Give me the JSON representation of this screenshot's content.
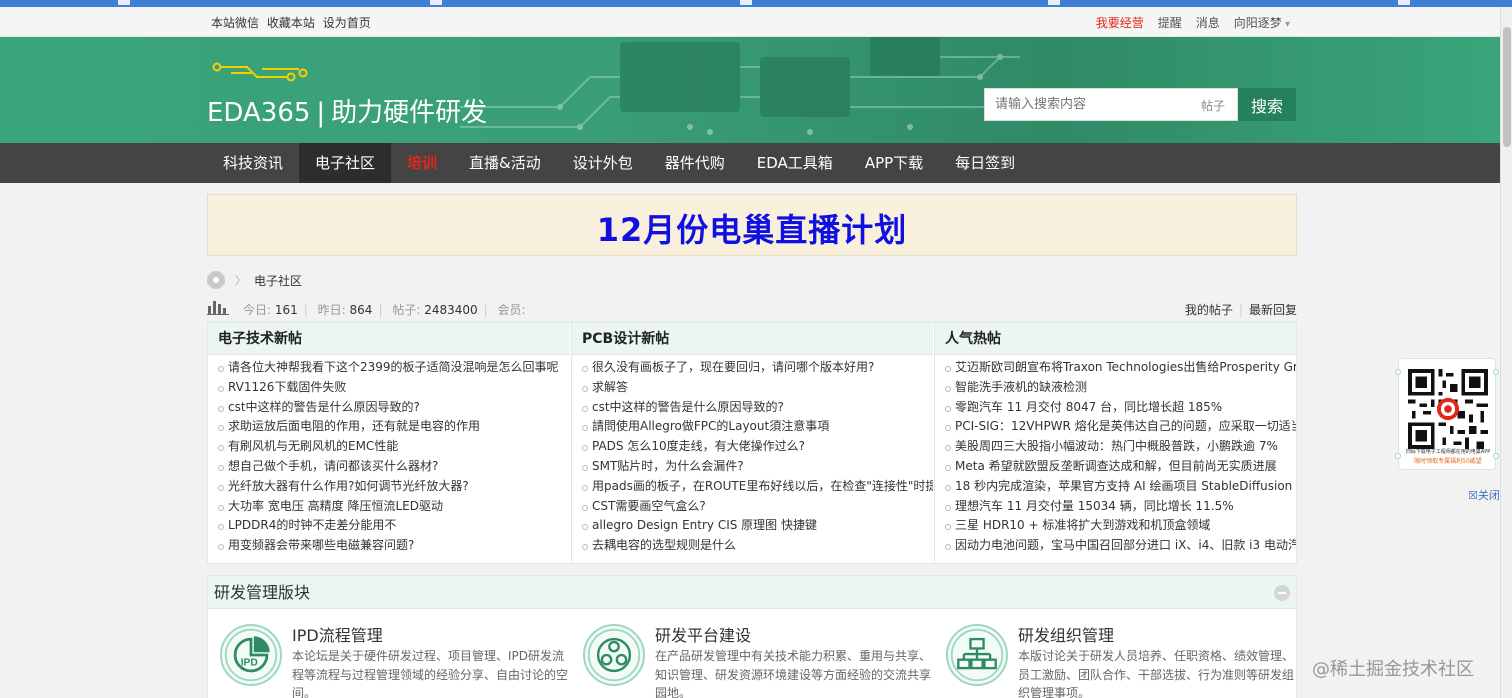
{
  "topbar": {
    "links": [
      "本站微信",
      "收藏本站",
      "设为首页"
    ],
    "right": {
      "biz": "我要经营",
      "remind": "提醒",
      "msg": "消息",
      "user": "向阳逐梦"
    }
  },
  "header": {
    "logo_text": "EDA365",
    "slogan": "助力硬件研发",
    "search": {
      "placeholder": "请输入搜索内容",
      "scope": "帖子",
      "button": "搜索"
    }
  },
  "nav": {
    "items": [
      "科技资讯",
      "电子社区",
      "培训",
      "直播&活动",
      "设计外包",
      "器件代购",
      "EDA工具箱",
      "APP下载",
      "每日签到"
    ],
    "active_index": 1,
    "highlight_index": 2
  },
  "promo": {
    "title": "12月份电巢直播计划"
  },
  "breadcrumb": {
    "current": "电子社区"
  },
  "stats": {
    "today_label": "今日:",
    "today": "161",
    "yesterday_label": "昨日:",
    "yesterday": "864",
    "posts_label": "帖子:",
    "posts": "2483400",
    "members_label": "会员:",
    "my_posts": "我的帖子",
    "latest_reply": "最新回复"
  },
  "hot": {
    "col1": {
      "title": "电子技术新帖",
      "items": [
        "请各位大神帮我看下这个2399的板子适简没混响是怎么回事呢",
        "RV1126下载固件失败",
        "cst中这样的警告是什么原因导致的?",
        "求助运放后面电阻的作用，还有就是电容的作用",
        "有刷风机与无刷风机的EMC性能",
        "想自己做个手机，请问都该买什么器材?",
        "光纤放大器有什么作用?如何调节光纤放大器?",
        "大功率 宽电压 高精度 降压恒流LED驱动",
        "LPDDR4的时钟不走差分能用不",
        "用变频器会带来哪些电磁兼容问题?"
      ]
    },
    "col2": {
      "title": "PCB设计新帖",
      "items": [
        "很久没有画板子了，现在要回归，请问哪个版本好用?",
        "求解答",
        "cst中这样的警告是什么原因导致的?",
        "請問使用Allegro做FPC的Layout須注意事項",
        "PADS 怎么10度走线，有大佬操作过么?",
        "SMT贴片时，为什么会漏件?",
        "用pads画的板子，在ROUTE里布好线以后，在检查\"连接性\"时提示",
        "CST需要画空气盒么?",
        "allegro Design Entry CIS 原理图 快捷键",
        "去耦电容的选型规则是什么"
      ]
    },
    "col3": {
      "title": "人气热帖",
      "items": [
        "艾迈斯欧司朗宣布将Traxon Technologies出售给Prosperity Group",
        "智能洗手液机的缺液检测",
        "零跑汽车 11 月交付 8047 台，同比增长超 185%",
        "PCI-SIG：12VHPWR 熔化是英伟达自己的问题，应采取一切适当",
        "美股周四三大股指小幅波动：热门中概股普跌，小鹏跌逾 7%",
        "Meta 希望就欧盟反垄断调查达成和解，但目前尚无实质进展",
        "18 秒内完成渲染，苹果官方支持 AI 绘画项目 StableDiffusion",
        "理想汽车 11 月交付量 15034 辆，同比增长 11.5%",
        "三星 HDR10 + 标准将扩大到游戏和机顶盒领域",
        "因动力电池问题，宝马中国召回部分进口 iX、i4、旧款 i3 电动汽"
      ]
    }
  },
  "rd": {
    "title": "研发管理版块",
    "forums": [
      {
        "icon": "ipd-icon",
        "icon_label": "IPD",
        "title": "IPD流程管理",
        "desc": "本论坛是关于硬件研发过程、项目管理、IPD研发流程等流程与过程管理领域的经验分享、自由讨论的空间。"
      },
      {
        "icon": "platform-icon",
        "title": "研发平台建设",
        "desc": "在产品研发管理中有关技术能力积累、重用与共享、知识管理、研发资源环境建设等方面经验的交流共享园地。"
      },
      {
        "icon": "org-chart-icon",
        "title": "研发组织管理",
        "desc": "本版讨论关于研发人员培养、任职资格、绩效管理、员工激励、团队合作、干部选拔、行为准则等研发组织管理事项。"
      }
    ]
  },
  "float_qr": {
    "caption1": "扫码下载电子工程师都在用的电巢APP",
    "caption2": "限时领取专属福利50威望",
    "close": "关闭"
  },
  "watermark": "@稀土掘金技术社区",
  "colors": {
    "brand_green": "#3aa57a",
    "nav_bg": "#444444",
    "accent_red": "#e0281a",
    "promo_blue": "#1010e0"
  }
}
